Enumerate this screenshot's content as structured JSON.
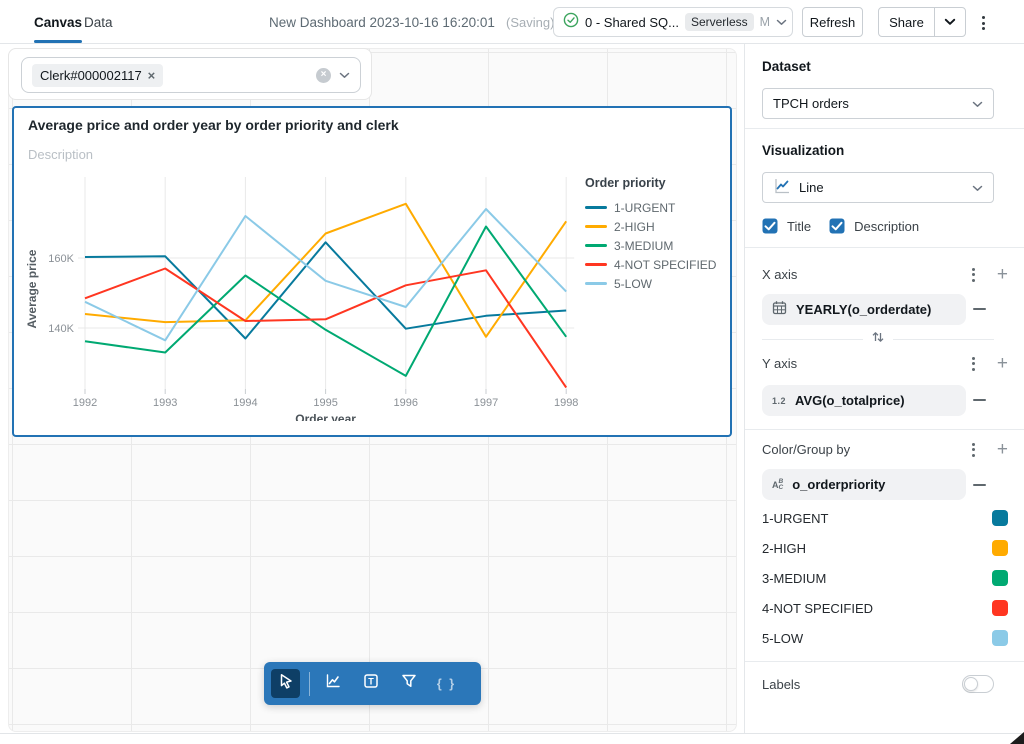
{
  "header": {
    "tab_canvas": "Canvas",
    "tab_data": "Data",
    "title": "New Dashboard 2023-10-16 16:20:01",
    "saving": "(Saving)",
    "warehouse_name": "0 - Shared SQ...",
    "warehouse_badge": "Serverless",
    "warehouse_size": "M",
    "refresh": "Refresh",
    "share": "Share"
  },
  "canvas": {
    "filter_chip": "Clerk#000002117",
    "filter_chip_remove": "×",
    "widget_title": "Average price and order year by order priority and clerk",
    "widget_description": "Description",
    "toolbar_tools": [
      "select",
      "line-chart",
      "text-box",
      "filter",
      "code"
    ],
    "code_tool_glyph": "{ }"
  },
  "chart_data": {
    "type": "line",
    "title": "Average price and order year by order priority and clerk",
    "xlabel": "Order year",
    "ylabel": "Average price",
    "legend_title": "Order priority",
    "legend_position": "right",
    "grid": true,
    "x": [
      1992,
      1993,
      1994,
      1995,
      1996,
      1997,
      1998
    ],
    "ylim": [
      121000,
      183500
    ],
    "y_ticks": [
      {
        "value": 160000,
        "label": "160K"
      },
      {
        "value": 140000,
        "label": "140K"
      }
    ],
    "series": [
      {
        "name": "1-URGENT",
        "color": "#077A9D",
        "values": [
          160300,
          160500,
          137000,
          164500,
          139800,
          143500,
          145000
        ]
      },
      {
        "name": "2-HIGH",
        "color": "#FFAB00",
        "values": [
          144000,
          141700,
          142200,
          167000,
          175500,
          137500,
          170500
        ]
      },
      {
        "name": "3-MEDIUM",
        "color": "#00A972",
        "values": [
          136200,
          133000,
          155000,
          139500,
          126300,
          169000,
          137500
        ]
      },
      {
        "name": "4-NOT SPECIFIED",
        "color": "#FF3621",
        "values": [
          148500,
          157000,
          142000,
          142500,
          152200,
          156500,
          123000
        ]
      },
      {
        "name": "5-LOW",
        "color": "#8BCAE7",
        "values": [
          147500,
          136500,
          172000,
          153500,
          146000,
          174000,
          150400
        ]
      }
    ]
  },
  "sidebar": {
    "dataset_label": "Dataset",
    "dataset_value": "TPCH orders",
    "visualization_label": "Visualization",
    "visualization_value": "Line",
    "title_checkbox": "Title",
    "description_checkbox": "Description",
    "x_axis_label": "X axis",
    "x_axis_field": "YEARLY(o_orderdate)",
    "y_axis_label": "Y axis",
    "y_axis_field": "AVG(o_totalprice)",
    "y_axis_field_icon": "1.2",
    "color_label": "Color/Group by",
    "color_field": "o_orderpriority",
    "color_values": [
      {
        "label": "1-URGENT",
        "color": "#077A9D"
      },
      {
        "label": "2-HIGH",
        "color": "#FFAB00"
      },
      {
        "label": "3-MEDIUM",
        "color": "#00A972"
      },
      {
        "label": "4-NOT SPECIFIED",
        "color": "#FF3621"
      },
      {
        "label": "5-LOW",
        "color": "#8BCAE7"
      }
    ],
    "labels_label": "Labels",
    "labels_enabled": false
  },
  "colors": {
    "accent": "#2272B4",
    "toolbar": "#2B77B9",
    "toolbar_selected": "#0E3F66",
    "success_green": "#3BA45D"
  }
}
